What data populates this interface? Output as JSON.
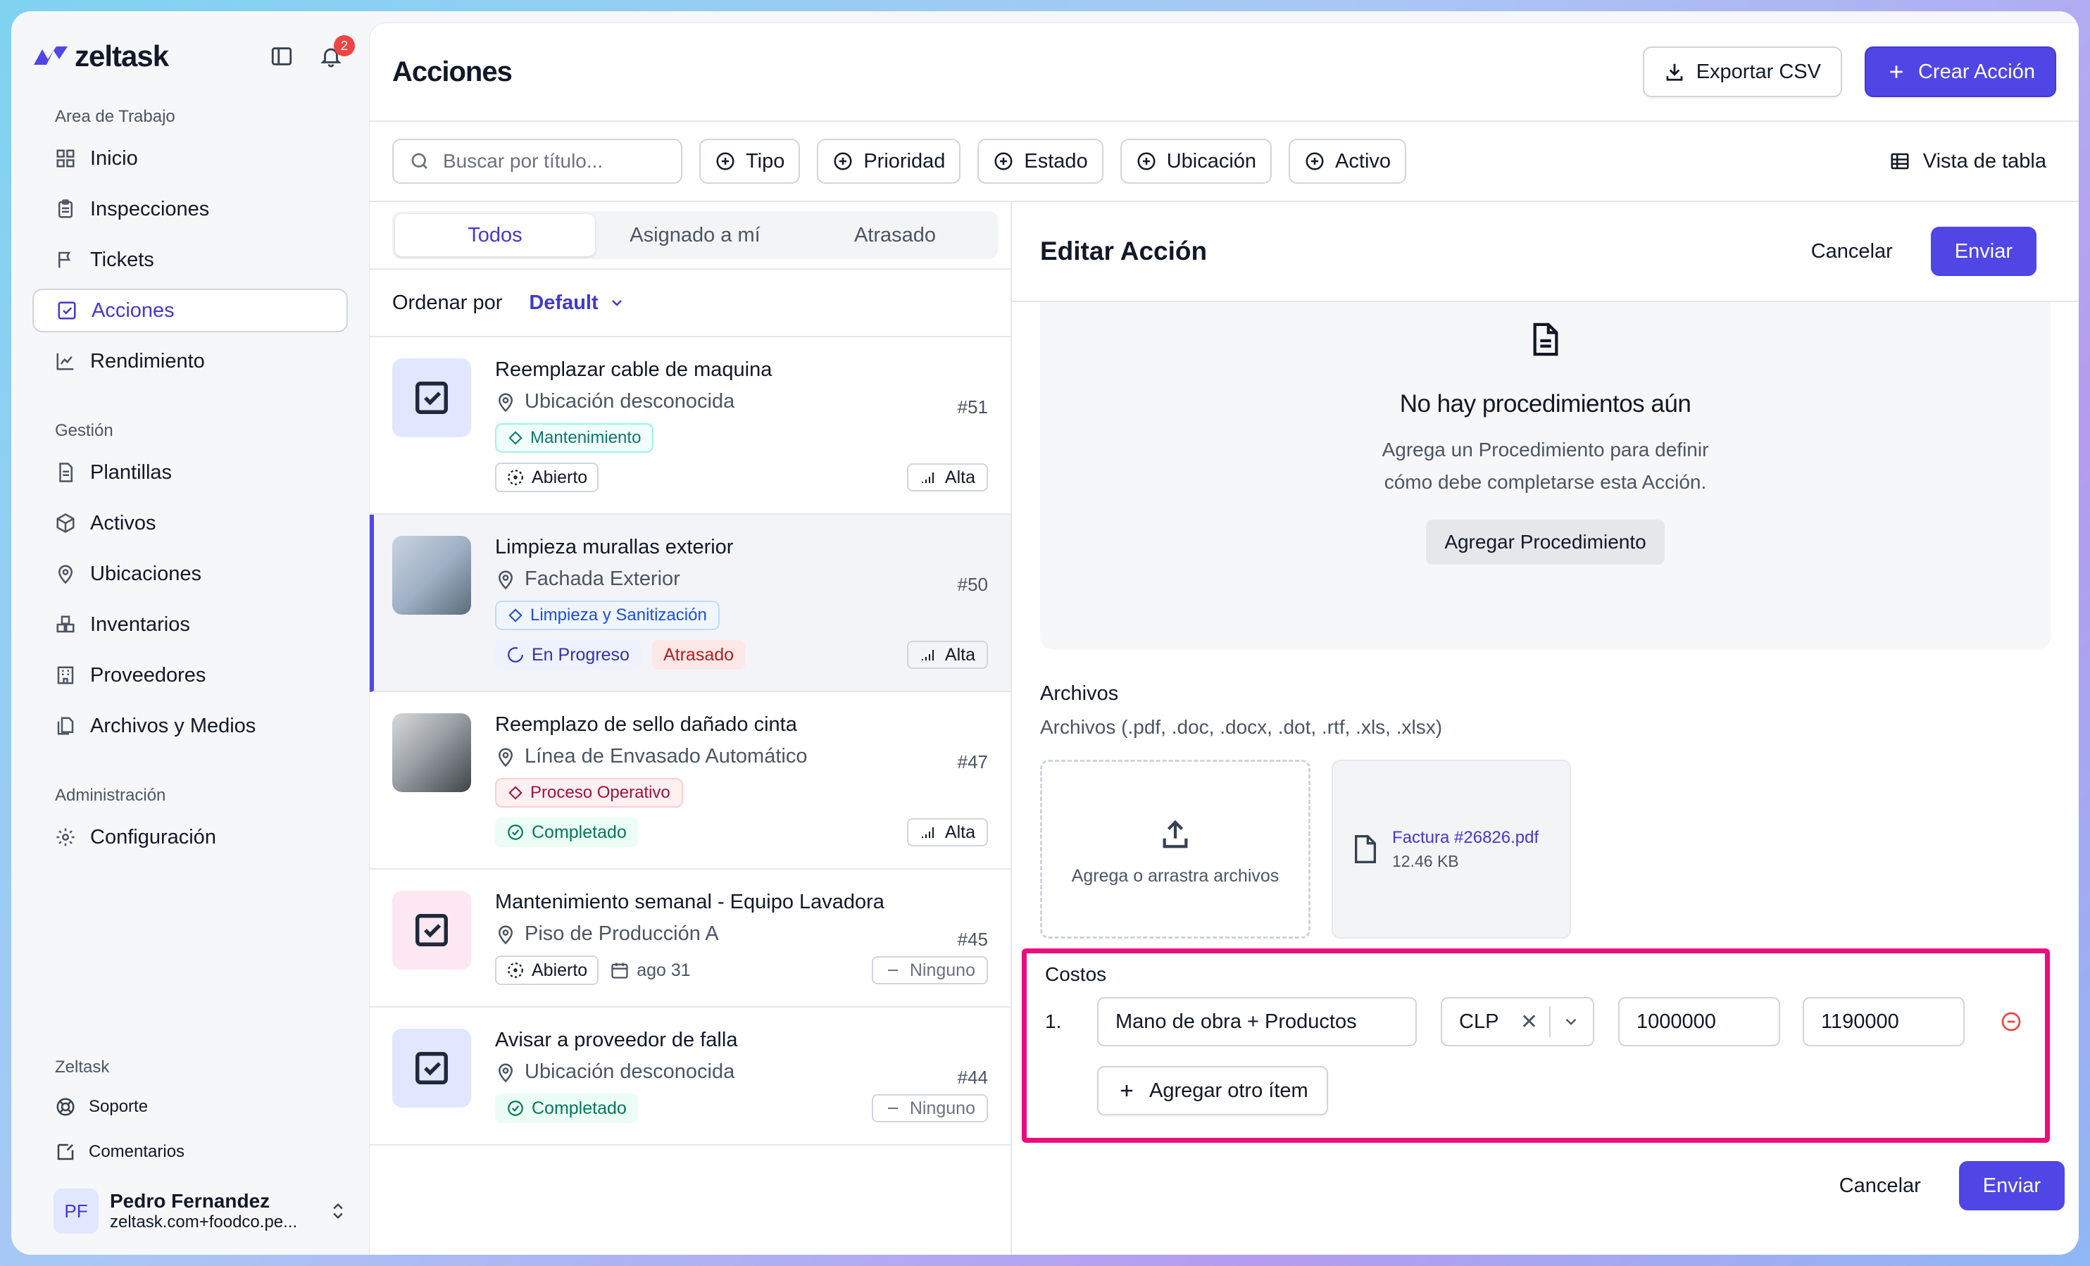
{
  "app": {
    "name": "zeltask",
    "notifications": "2"
  },
  "sidebar": {
    "workspace_label": "Area de Trabajo",
    "workspace_items": [
      {
        "label": "Inicio",
        "icon": "grid-icon"
      },
      {
        "label": "Inspecciones",
        "icon": "clipboard-icon"
      },
      {
        "label": "Tickets",
        "icon": "flag-icon"
      },
      {
        "label": "Acciones",
        "icon": "checkbox-icon",
        "active": true
      },
      {
        "label": "Rendimiento",
        "icon": "chart-icon"
      }
    ],
    "manage_label": "Gestión",
    "manage_items": [
      {
        "label": "Plantillas"
      },
      {
        "label": "Activos"
      },
      {
        "label": "Ubicaciones"
      },
      {
        "label": "Inventarios"
      },
      {
        "label": "Proveedores"
      },
      {
        "label": "Archivos y Medios"
      }
    ],
    "admin_label": "Administración",
    "admin_items": [
      {
        "label": "Configuración"
      }
    ],
    "footer_label": "Zeltask",
    "footer_items": [
      {
        "label": "Soporte"
      },
      {
        "label": "Comentarios"
      }
    ],
    "user": {
      "initials": "PF",
      "name": "Pedro Fernandez",
      "email": "zeltask.com+foodco.pe..."
    }
  },
  "header": {
    "title": "Acciones",
    "export_label": "Exportar CSV",
    "create_label": "Crear Acción"
  },
  "filters": {
    "search_placeholder": "Buscar por título...",
    "chips": [
      "Tipo",
      "Prioridad",
      "Estado",
      "Ubicación",
      "Activo"
    ],
    "view_label": "Vista de tabla"
  },
  "list": {
    "tabs": [
      "Todos",
      "Asignado a mí",
      "Atrasado"
    ],
    "sort_label": "Ordenar por",
    "sort_value": "Default",
    "cards": [
      {
        "title": "Reemplazar cable de maquina",
        "location": "Ubicación desconocida",
        "num": "#51",
        "tag": "Mantenimiento",
        "status": "Abierto",
        "priority": "Alta"
      },
      {
        "title": "Limpieza murallas exterior",
        "location": "Fachada Exterior",
        "num": "#50",
        "tag": "Limpieza y Sanitización",
        "status": "En Progreso",
        "late": "Atrasado",
        "priority": "Alta"
      },
      {
        "title": "Reemplazo de sello dañado cinta",
        "location": "Línea de Envasado Automático",
        "num": "#47",
        "tag": "Proceso Operativo",
        "status": "Completado",
        "priority": "Alta"
      },
      {
        "title": "Mantenimiento semanal - Equipo Lavadora",
        "location": "Piso de Producción A",
        "num": "#45",
        "status": "Abierto",
        "date": "ago 31",
        "priority": "Ninguno"
      },
      {
        "title": "Avisar a proveedor de falla",
        "location": "Ubicación desconocida",
        "num": "#44",
        "status": "Completado",
        "priority": "Ninguno"
      }
    ]
  },
  "detail": {
    "title": "Editar Acción",
    "cancel_label": "Cancelar",
    "submit_label": "Enviar",
    "empty_title": "No hay procedimientos aún",
    "empty_desc_1": "Agrega un Procedimiento para definir",
    "empty_desc_2": "cómo debe completarse esta Acción.",
    "empty_button": "Agregar Procedimiento",
    "files_label": "Archivos",
    "files_hint": "Archivos (.pdf, .doc, .docx, .dot, .rtf, .xls, .xlsx)",
    "dropzone_label": "Agrega o arrastra archivos",
    "file": {
      "name": "Factura #26826.pdf",
      "size": "12.46 KB"
    },
    "costs_label": "Costos",
    "cost_row": {
      "index": "1.",
      "description": "Mano de obra + Productos",
      "currency": "CLP",
      "amount": "1000000",
      "total": "1190000"
    },
    "add_item_label": "Agregar otro ítem"
  },
  "colors": {
    "accent": "#4f46e5",
    "highlight": "#ec0c7d"
  }
}
